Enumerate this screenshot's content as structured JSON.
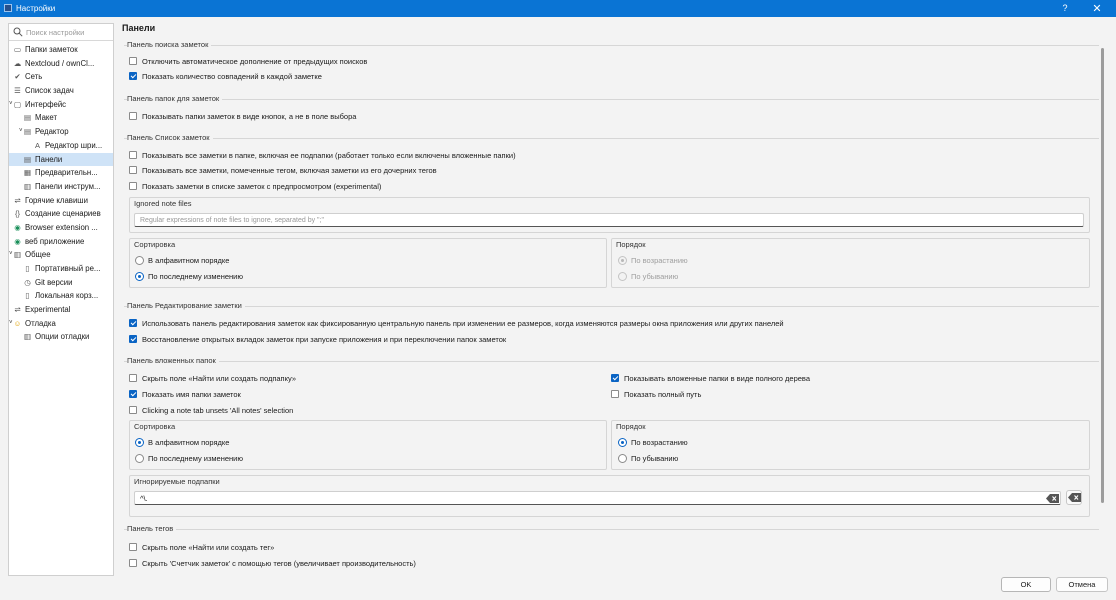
{
  "window": {
    "title": "Настройки",
    "help_label": "?",
    "close_label": "✕"
  },
  "search": {
    "placeholder": "Поиск настройки"
  },
  "sidebar": {
    "items": [
      {
        "label": "Папки заметок",
        "icon": "folder-icon",
        "glyph": "▭"
      },
      {
        "label": "Nextcloud / ownCl...",
        "icon": "cloud-icon",
        "glyph": "☁"
      },
      {
        "label": "Сеть",
        "icon": "network-icon",
        "glyph": "✔"
      },
      {
        "label": "Список задач",
        "icon": "checklist-icon",
        "glyph": "☰"
      },
      {
        "label": "Интерфейс",
        "icon": "interface-icon",
        "glyph": "▢"
      },
      {
        "label": "Макет",
        "icon": "layout-icon",
        "glyph": "▤"
      },
      {
        "label": "Редактор",
        "icon": "editor-icon",
        "glyph": "▤"
      },
      {
        "label": "Редактор шри...",
        "icon": "font-icon",
        "glyph": "A"
      },
      {
        "label": "Панели",
        "icon": "panels-icon",
        "glyph": "▤"
      },
      {
        "label": "Предварительн...",
        "icon": "preview-icon",
        "glyph": "▦"
      },
      {
        "label": "Панели инструм...",
        "icon": "toolbars-icon",
        "glyph": "▥"
      },
      {
        "label": "Горячие клавиши",
        "icon": "shortcuts-icon",
        "glyph": "⇌"
      },
      {
        "label": "Создание сценариев",
        "icon": "script-icon",
        "glyph": "{}"
      },
      {
        "label": "Browser extension ...",
        "icon": "browser-extension-icon",
        "glyph": "◉"
      },
      {
        "label": "веб приложение",
        "icon": "web-app-icon",
        "glyph": "◉"
      },
      {
        "label": "Общее",
        "icon": "general-icon",
        "glyph": "▥"
      },
      {
        "label": "Портативный ре...",
        "icon": "portable-icon",
        "glyph": "▯"
      },
      {
        "label": "Git версии",
        "icon": "git-icon",
        "glyph": "◷"
      },
      {
        "label": "Локальная корз...",
        "icon": "trash-icon",
        "glyph": "▯"
      },
      {
        "label": "Experimental",
        "icon": "experimental-icon",
        "glyph": "⇌"
      },
      {
        "label": "Отладка",
        "icon": "debug-icon",
        "glyph": "☺"
      },
      {
        "label": "Опции отладки",
        "icon": "debug-options-icon",
        "glyph": "▥"
      }
    ]
  },
  "page": {
    "title": "Панели"
  },
  "search_panel": {
    "title": "Панель поиска заметок",
    "disable_autocomplete": "Отключить автоматическое дополнение от предыдущих поисков",
    "show_match_count": "Показать количество совпадений в каждой заметке"
  },
  "folders_panel": {
    "title": "Панель папок для заметок",
    "show_as_buttons": "Показывать папки заметок в виде кнопок, а не в поле выбора"
  },
  "notes_list_panel": {
    "title": "Панель Список заметок",
    "show_all_in_folder": "Показывать все заметки в папке, включая ее подпапки (работает только если включены вложенные папки)",
    "show_all_tagged": "Показывать все заметки, помеченные тегом, включая заметки из его дочерних тегов",
    "show_preview": "Показать заметки в списке заметок с предпросмотром (experimental)",
    "ignored_label": "Ignored note files",
    "ignored_placeholder": "Regular expressions of note files to ignore, separated by \";\"",
    "sort_title": "Сортировка",
    "sort_alpha": "В алфавитном порядке",
    "sort_modified": "По последнему изменению",
    "order_title": "Порядок",
    "order_asc": "По возрастанию",
    "order_desc": "По убыванию"
  },
  "edit_panel": {
    "title": "Панель Редактирование заметки",
    "fixed_central": "Использовать панель редактирования заметок как фиксированную центральную панель при изменении ее размеров, когда изменяются размеры окна приложения или других панелей",
    "restore_tabs": "Восстановление открытых вкладок заметок при запуске приложения и при переключении папок заметок"
  },
  "subfolders_panel": {
    "title": "Панель вложенных папок",
    "hide_find_field": "Скрыть поле «Найти или создать подпапку»",
    "show_folder_name": "Показать имя папки заметок",
    "clicking_tab": "Clicking a note tab unsets 'All notes' selection",
    "show_full_tree": "Показывать вложенные папки в виде полного дерева",
    "show_full_path": "Показать полный путь",
    "sort_title": "Сортировка",
    "sort_alpha": "В алфавитном порядке",
    "sort_modified": "По последнему изменению",
    "order_title": "Порядок",
    "order_asc": "По возрастанию",
    "order_desc": "По убыванию",
    "ignored_label": "Игнорируемые подпапки",
    "ignored_value": "^\\."
  },
  "tags_panel": {
    "title": "Панель тегов",
    "hide_find_field": "Скрыть поле «Найти или создать тег»",
    "hide_note_counter": "Скрыть 'Счетчик заметок' с помощью тегов (увеличивает производительность)"
  },
  "footer": {
    "ok_label": "OK",
    "cancel_label": "Отмена"
  },
  "colors": {
    "accent": "#0a64c4",
    "titlebar": "#0a74d4",
    "selection": "#cfe3f7"
  }
}
